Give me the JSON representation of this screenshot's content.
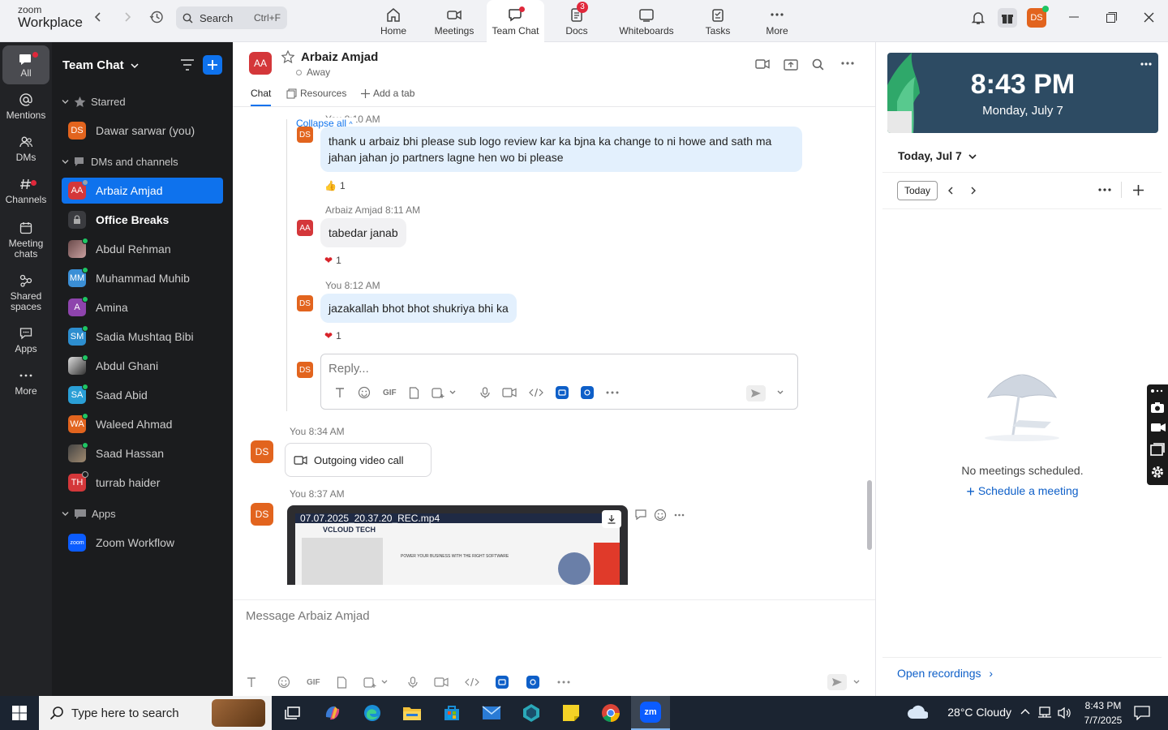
{
  "app": {
    "logo_top": "zoom",
    "logo_bottom": "Workplace"
  },
  "topbar": {
    "search_placeholder": "Search",
    "search_shortcut": "Ctrl+F",
    "nav": [
      {
        "label": "Home"
      },
      {
        "label": "Meetings"
      },
      {
        "label": "Team Chat"
      },
      {
        "label": "Docs",
        "badge": "3"
      },
      {
        "label": "Whiteboards"
      },
      {
        "label": "Tasks"
      },
      {
        "label": "More"
      }
    ],
    "profile_initials": "DS"
  },
  "rail": {
    "items": [
      {
        "label": "All"
      },
      {
        "label": "Mentions"
      },
      {
        "label": "DMs"
      },
      {
        "label": "Channels"
      },
      {
        "label": "Meeting chats"
      },
      {
        "label": "Shared spaces"
      },
      {
        "label": "Apps"
      },
      {
        "label": "More"
      }
    ]
  },
  "sidebar": {
    "title": "Team Chat",
    "sections": {
      "starred": "Starred",
      "dms": "DMs and channels",
      "apps": "Apps"
    },
    "starred": [
      {
        "initials": "DS",
        "name": "Dawar sarwar (you)"
      }
    ],
    "dms": [
      {
        "initials": "AA",
        "name": "Arbaiz Amjad"
      },
      {
        "initials": "",
        "name": "Office Breaks"
      },
      {
        "initials": "",
        "name": "Abdul Rehman"
      },
      {
        "initials": "MM",
        "name": "Muhammad Muhib"
      },
      {
        "initials": "A",
        "name": "Amina"
      },
      {
        "initials": "SM",
        "name": "Sadia Mushtaq Bibi"
      },
      {
        "initials": "",
        "name": "Abdul Ghani"
      },
      {
        "initials": "SA",
        "name": "Saad Abid"
      },
      {
        "initials": "WA",
        "name": "Waleed Ahmad"
      },
      {
        "initials": "",
        "name": "Saad Hassan"
      },
      {
        "initials": "TH",
        "name": "turrab haider"
      }
    ],
    "apps": [
      {
        "initials": "zoom",
        "name": "Zoom Workflow"
      }
    ]
  },
  "chat": {
    "peer_initials": "AA",
    "peer_name": "Arbaiz Amjad",
    "peer_status": "Away",
    "tabs": {
      "chat": "Chat",
      "resources": "Resources",
      "add": "Add a tab"
    },
    "collapse_all": "Collapse all",
    "first_meta": "You 8:10 AM",
    "msg1": "thank u arbaiz bhi please sub logo review kar ka bjna ka change to ni howe and sath ma jahan jahan jo partners lagne hen wo bi please",
    "msg1_reaction": "1",
    "msg2_meta": "Arbaiz Amjad 8:11 AM",
    "msg2": "tabedar janab",
    "msg2_reaction": "1",
    "msg3_meta": "You 8:12 AM",
    "msg3": "jazakallah bhot bhot shukriya bhi ka",
    "msg3_reaction": "1",
    "reply_placeholder": "Reply...",
    "call_meta": "You 8:34 AM",
    "call_label": "Outgoing video call",
    "video_meta": "You 8:37 AM",
    "video_name": "07.07.2025_20.37.20_REC.mp4",
    "video_preview_brand": "VCLOUD TECH",
    "video_preview_text": "POWER YOUR BUSINESS WITH THE RIGHT SOFTWARE",
    "message_placeholder": "Message Arbaiz Amjad",
    "gif_label": "GIF",
    "my_initials": "DS"
  },
  "calendar": {
    "time": "8:43 PM",
    "date": "Monday, July 7",
    "today_heading": "Today, Jul 7",
    "today_button": "Today",
    "empty": "No meetings scheduled.",
    "schedule": "Schedule a meeting",
    "open_recordings": "Open recordings"
  },
  "taskbar": {
    "search_placeholder": "Type here to search",
    "weather": "28°C  Cloudy",
    "time": "8:43 PM",
    "date": "7/7/2025"
  },
  "colors": {
    "accent": "#0e72ed",
    "rail_bg": "#222326",
    "sidebar_bg": "#1b1c1e",
    "alert": "#e0283b"
  }
}
